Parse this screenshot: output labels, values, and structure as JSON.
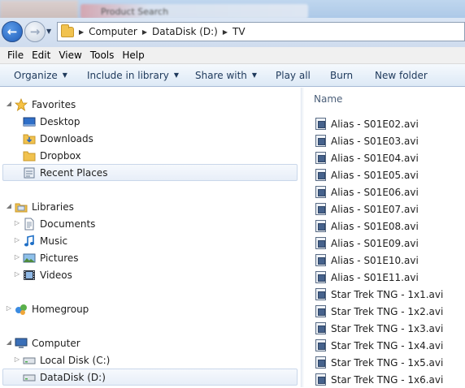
{
  "window": {
    "background_tab_text": "Product Search"
  },
  "address": {
    "back_label": "Back",
    "forward_label": "Forward",
    "crumbs": [
      "Computer",
      "DataDisk (D:)",
      "TV"
    ]
  },
  "menu": [
    "File",
    "Edit",
    "View",
    "Tools",
    "Help"
  ],
  "commands": {
    "organize": "Organize",
    "include_in_library": "Include in library",
    "share_with": "Share with",
    "play_all": "Play all",
    "burn": "Burn",
    "new_folder": "New folder"
  },
  "nav": {
    "favorites": {
      "label": "Favorites",
      "items": [
        "Desktop",
        "Downloads",
        "Dropbox",
        "Recent Places"
      ]
    },
    "libraries": {
      "label": "Libraries",
      "items": [
        "Documents",
        "Music",
        "Pictures",
        "Videos"
      ]
    },
    "homegroup": {
      "label": "Homegroup"
    },
    "computer": {
      "label": "Computer",
      "items": [
        "Local Disk (C:)",
        "DataDisk (D:)"
      ]
    }
  },
  "content": {
    "column_name": "Name",
    "files": [
      "Alias - S01E02.avi",
      "Alias - S01E03.avi",
      "Alias - S01E04.avi",
      "Alias - S01E05.avi",
      "Alias - S01E06.avi",
      "Alias - S01E07.avi",
      "Alias - S01E08.avi",
      "Alias - S01E09.avi",
      "Alias - S01E10.avi",
      "Alias - S01E11.avi",
      "Star Trek TNG - 1x1.avi",
      "Star Trek TNG - 1x2.avi",
      "Star Trek TNG - 1x3.avi",
      "Star Trek TNG - 1x4.avi",
      "Star Trek TNG - 1x5.avi",
      "Star Trek TNG - 1x6.avi"
    ]
  },
  "colors": {
    "accent": "#1e395b",
    "selection_bg": "#e7eef8",
    "command_bar": "#dde9f6"
  }
}
